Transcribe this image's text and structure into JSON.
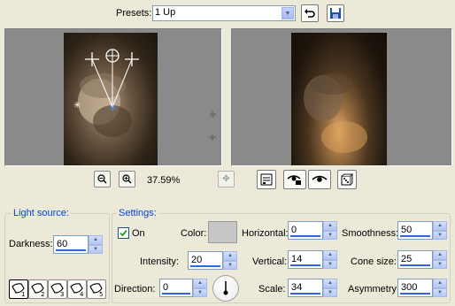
{
  "presets": {
    "label": "Presets:",
    "value": "1 Up"
  },
  "zoom": {
    "level": "37.59%"
  },
  "light_source": {
    "title": "Light source:",
    "darkness_label": "Darkness:",
    "darkness_value": "60",
    "lights": [
      "1",
      "2",
      "3",
      "4",
      "5"
    ]
  },
  "settings": {
    "title": "Settings:",
    "on_label": "On",
    "on_checked": true,
    "color_label": "Color:",
    "color_value": "#c6c6c6",
    "intensity_label": "Intensity:",
    "intensity_value": "20",
    "direction_label": "Direction:",
    "direction_value": "0",
    "horizontal_label": "Horizontal:",
    "horizontal_value": "0",
    "vertical_label": "Vertical:",
    "vertical_value": "14",
    "scale_label": "Scale:",
    "scale_value": "34",
    "smoothness_label": "Smoothness:",
    "smoothness_value": "50",
    "cone_size_label": "Cone size:",
    "cone_size_value": "25",
    "asymmetry_label": "Asymmetry:",
    "asymmetry_value": "300"
  },
  "icons": {
    "reset": "reset-arrow-icon",
    "save": "save-disk-icon",
    "zoom_out": "zoom-out-icon",
    "zoom_in": "zoom-in-icon",
    "pan": "pan-move-icon",
    "proof": "proof-toggle-icon",
    "eye_lock": "eye-lock-icon",
    "eye": "eye-icon",
    "randomize": "dice-icon"
  }
}
